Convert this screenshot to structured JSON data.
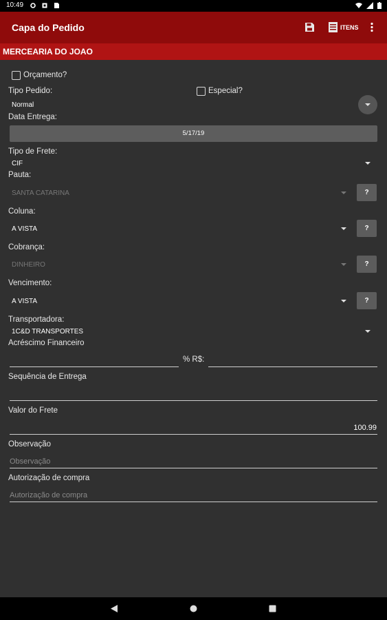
{
  "status_bar": {
    "time": "10:49"
  },
  "app_bar": {
    "title": "Capa do Pedido",
    "items_label": "ITENS"
  },
  "customer": {
    "name": "MERCEARIA DO JOAO"
  },
  "form": {
    "orcamento_label": "Orçamento?",
    "tipo_pedido_label": "Tipo Pedido:",
    "especial_label": "Especial?",
    "tipo_pedido_value": "Normal",
    "data_entrega_label": "Data Entrega:",
    "data_entrega_value": "5/17/19",
    "tipo_frete_label": "Tipo de Frete:",
    "tipo_frete_value": "CIF",
    "pauta_label": "Pauta:",
    "pauta_value": "SANTA CATARINA",
    "coluna_label": "Coluna:",
    "coluna_value": "A VISTA",
    "cobranca_label": "Cobrança:",
    "cobranca_value": "DINHEIRO",
    "vencimento_label": "Vencimento:",
    "vencimento_value": "A VISTA",
    "transportadora_label": "Transportadora:",
    "transportadora_value": "1C&D TRANSPORTES",
    "acrescimo_label": "Acréscimo Financeiro",
    "acrescimo_unit": "% R$:",
    "sequencia_label": "Sequência de Entrega",
    "valor_frete_label": "Valor do Frete",
    "valor_frete_value": "100.99",
    "observacao_label": "Observação",
    "observacao_placeholder": "Observação",
    "autorizacao_label": "Autorização de compra",
    "autorizacao_placeholder": "Autorização de compra",
    "help_button_label": "?"
  }
}
